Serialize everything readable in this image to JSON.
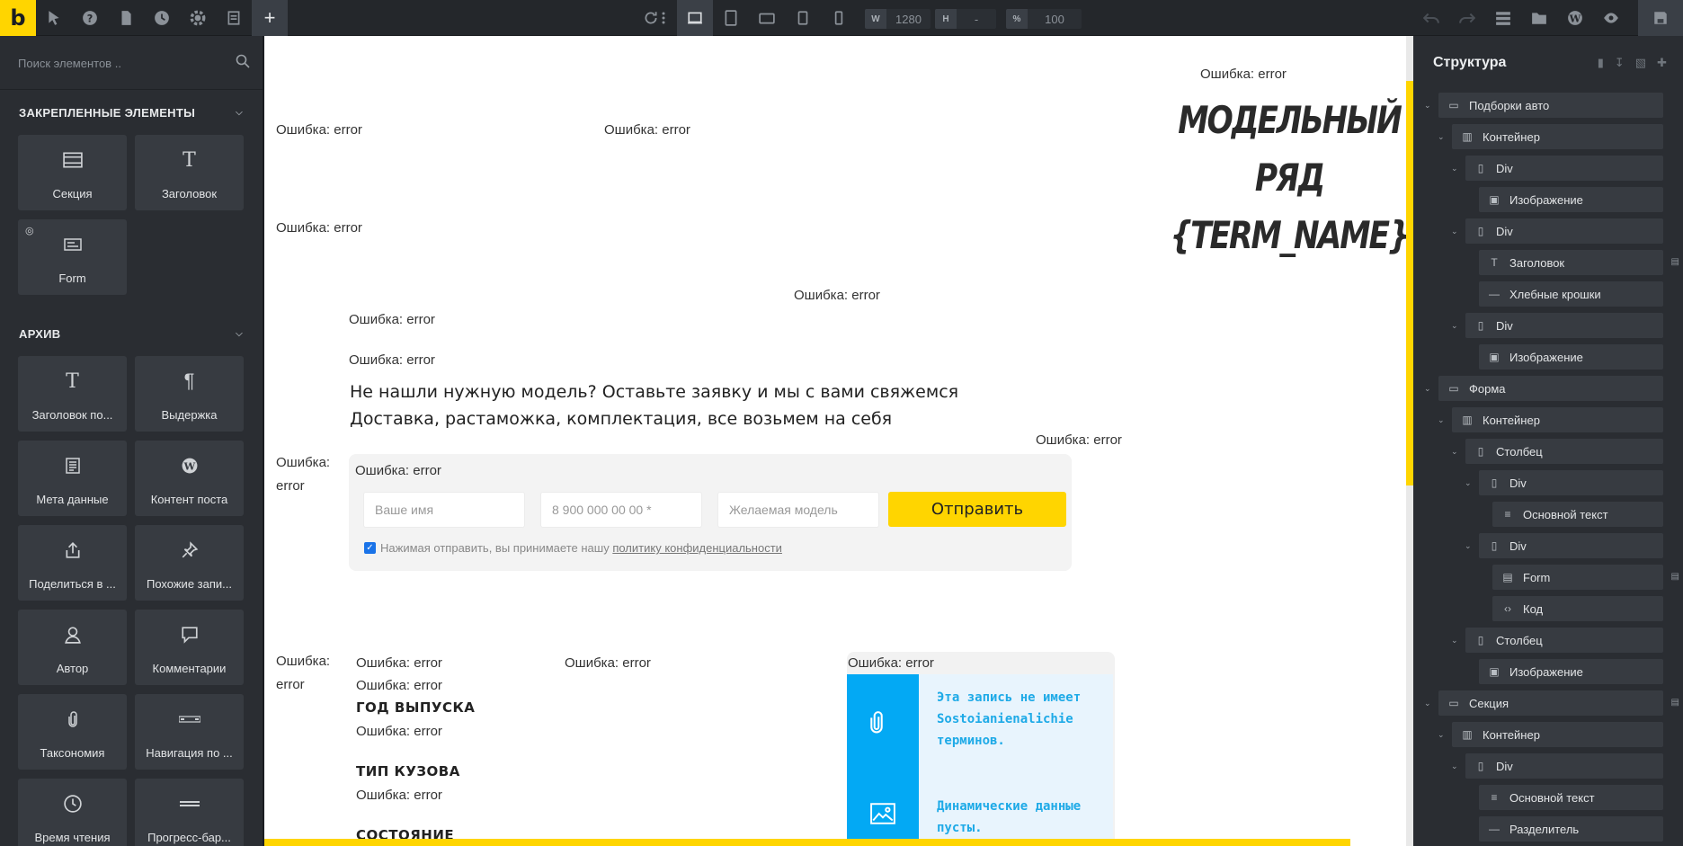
{
  "toolbar": {
    "logo": "b",
    "width_label": "W",
    "width_value": "1280",
    "height_label": "H",
    "height_value": "-",
    "zoom_label": "%",
    "zoom_value": "100"
  },
  "left_panel": {
    "search_placeholder": "Поиск элементов ..",
    "pinned_title": "ЗАКРЕПЛЕННЫЕ ЭЛЕМЕНТЫ",
    "pinned_items": [
      {
        "label": "Секция",
        "icon": "section-icon"
      },
      {
        "label": "Заголовок",
        "icon": "heading-icon"
      },
      {
        "label": "Form",
        "icon": "form-icon"
      }
    ],
    "archive_title": "АРХИВ",
    "archive_items": [
      {
        "label": "Заголовок по...",
        "icon": "heading-icon"
      },
      {
        "label": "Выдержка",
        "icon": "pilcrow-icon"
      },
      {
        "label": "Мета данные",
        "icon": "meta-icon"
      },
      {
        "label": "Контент поста",
        "icon": "wordpress-icon"
      },
      {
        "label": "Поделиться в ...",
        "icon": "share-icon"
      },
      {
        "label": "Похожие запи...",
        "icon": "pin-icon"
      },
      {
        "label": "Автор",
        "icon": "user-icon"
      },
      {
        "label": "Комментарии",
        "icon": "comment-icon"
      },
      {
        "label": "Таксономия",
        "icon": "clip-icon"
      },
      {
        "label": "Навигация по ...",
        "icon": "nav-icon"
      },
      {
        "label": "Время чтения",
        "icon": "clock-icon"
      },
      {
        "label": "Прогресс-бар...",
        "icon": "progress-icon"
      }
    ]
  },
  "canvas": {
    "error_text": "Ошибка: error",
    "error_word": "Ошибка:",
    "error_value": "error",
    "hero_title_line1": "МОДЕЛЬНЫЙ РЯД",
    "hero_title_line2": "{TERM_NAME}",
    "cta_line1": "Не нашли нужную модель? Оставьте заявку и мы с вами свяжемся",
    "cta_line2": "Доставка, растаможка, комплектация, все возьмем на себя",
    "form": {
      "name_placeholder": "Ваше имя",
      "phone_placeholder": "8 900 000 00 00 *",
      "model_placeholder": "Желаемая модель",
      "submit_label": "Отправить",
      "consent_text": "Нажимая отправить, вы принимаете нашу",
      "consent_link": "политику конфиденциальности"
    },
    "spec_year": "ГОД ВЫПУСКА",
    "spec_body": "ТИП КУЗОВА",
    "spec_condition": "СОСТОЯНИЕ",
    "notice_line1": "Эта запись не имеет Sostoianienalichie терминов.",
    "notice_line2": "Динамические данные пусты."
  },
  "structure": {
    "title": "Структура",
    "nodes": [
      {
        "label": "Подборки авто",
        "icon": "section-icon"
      },
      {
        "label": "Контейнер",
        "icon": "container-icon"
      },
      {
        "label": "Div",
        "icon": "div-icon"
      },
      {
        "label": "Изображение",
        "icon": "image-icon"
      },
      {
        "label": "Div",
        "icon": "div-icon"
      },
      {
        "label": "Заголовок",
        "icon": "heading-icon"
      },
      {
        "label": "Хлебные крошки",
        "icon": "breadcrumbs-icon"
      },
      {
        "label": "Div",
        "icon": "div-icon"
      },
      {
        "label": "Изображение",
        "icon": "image-icon"
      },
      {
        "label": "Форма",
        "icon": "section-icon"
      },
      {
        "label": "Контейнер",
        "icon": "container-icon"
      },
      {
        "label": "Столбец",
        "icon": "div-icon"
      },
      {
        "label": "Div",
        "icon": "div-icon"
      },
      {
        "label": "Основной текст",
        "icon": "text-icon"
      },
      {
        "label": "Div",
        "icon": "div-icon"
      },
      {
        "label": "Form",
        "icon": "form-icon"
      },
      {
        "label": "Код",
        "icon": "code-icon"
      },
      {
        "label": "Столбец",
        "icon": "div-icon"
      },
      {
        "label": "Изображение",
        "icon": "image-icon"
      },
      {
        "label": "Секция",
        "icon": "section-icon"
      },
      {
        "label": "Контейнер",
        "icon": "container-icon"
      },
      {
        "label": "Div",
        "icon": "div-icon"
      },
      {
        "label": "Основной текст",
        "icon": "text-icon"
      },
      {
        "label": "Разделитель",
        "icon": "divider-icon"
      }
    ]
  },
  "colors": {
    "accent": "#ffd500",
    "panel": "#2a2d32",
    "notice_bar": "#03a9f4",
    "notice_bg": "#e8f4fd"
  }
}
